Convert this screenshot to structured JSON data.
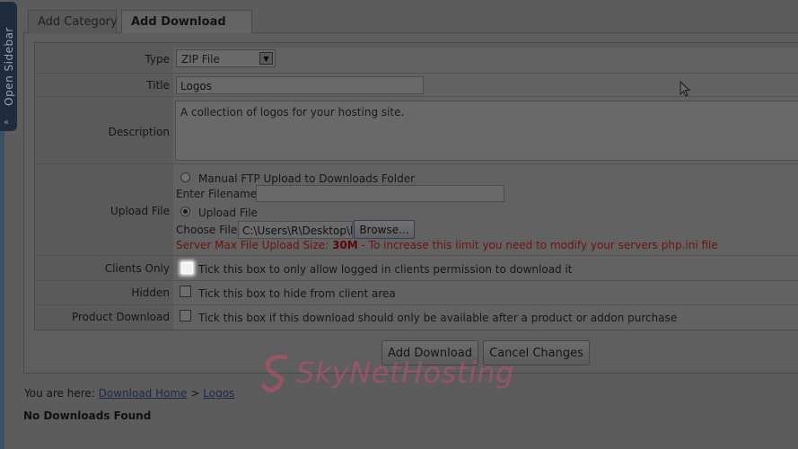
{
  "sidebar": {
    "label": "Open Sidebar",
    "arrows": "«"
  },
  "tabs": [
    {
      "label": "Add Category"
    },
    {
      "label": "Add Download"
    }
  ],
  "form": {
    "type": {
      "label": "Type",
      "value": "ZIP File"
    },
    "title": {
      "label": "Title",
      "value": "Logos"
    },
    "description": {
      "label": "Description",
      "value": "A collection of logos for your hosting site."
    },
    "upload": {
      "label": "Upload File",
      "ftp_option": "Manual FTP Upload to Downloads Folder",
      "filename_label": "Enter Filename:",
      "filename_value": "",
      "upload_option": "Upload File",
      "choose_label": "Choose File:",
      "choose_value": "C:\\Users\\R\\Desktop\\lo",
      "browse_label": "Browse...",
      "max_prefix": "Server Max File Upload Size:",
      "max_size": "30M",
      "max_suffix": "- To increase this limit you need to modify your servers php.ini file"
    },
    "clients_only": {
      "label": "Clients Only",
      "text": "Tick this box to only allow logged in clients permission to download it"
    },
    "hidden": {
      "label": "Hidden",
      "text": "Tick this box to hide from client area"
    },
    "product_download": {
      "label": "Product Download",
      "text": "Tick this box if this download should only be available after a product or addon purchase"
    }
  },
  "buttons": {
    "add": "Add Download",
    "cancel": "Cancel Changes"
  },
  "breadcrumb": {
    "prefix": "You are here:",
    "home": "Download Home",
    "sep": ">",
    "current": "Logos"
  },
  "status": "No Downloads Found",
  "watermark": {
    "text": "SkyNetHosting"
  },
  "colors": {
    "overlay": "#5c5c5c",
    "warning": "#6e1212",
    "sidebar": "#1e2c3e"
  }
}
